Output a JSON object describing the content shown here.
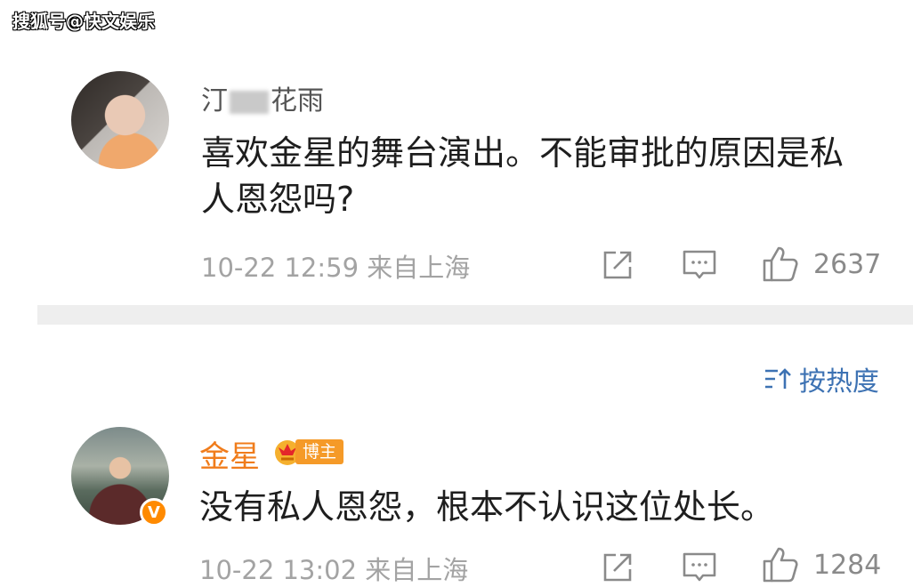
{
  "watermark": "搜狐号@快文娱乐",
  "comments": [
    {
      "username_prefix": "汀",
      "username_suffix": "花雨",
      "text": "喜欢金星的舞台演出。不能审批的原因是私人恩怨吗?",
      "time": "10-22 12:59",
      "location": "来自上海",
      "likes": "2637"
    },
    {
      "username": "金星",
      "badge": "博主",
      "verified_mark": "V",
      "text": "没有私人恩怨，根本不认识这位处长。",
      "time": "10-22 13:02",
      "location": "来自上海",
      "likes": "1284"
    }
  ],
  "sort": {
    "label": "按热度",
    "icon": "sort-icon"
  },
  "icons": [
    "share-icon",
    "comment-icon",
    "like-icon"
  ],
  "colors": {
    "accent": "#f07c1b",
    "link": "#3d72b3",
    "meta": "#a3a3a3",
    "divider": "#eeeeee"
  }
}
